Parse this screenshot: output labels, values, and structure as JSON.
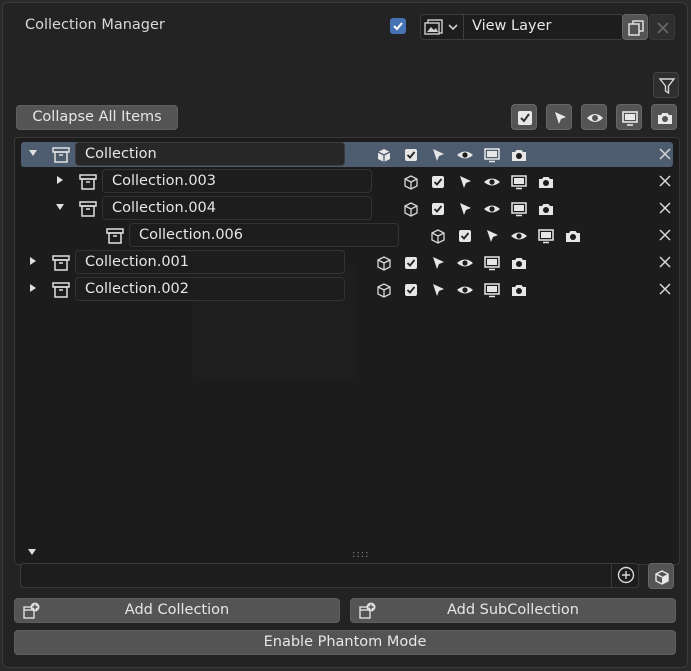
{
  "header": {
    "title": "Collection Manager",
    "view_layer_label": "View Layer"
  },
  "toolbar": {
    "collapse_label": "Collapse All Items"
  },
  "tree": [
    {
      "name": "Collection",
      "expanded": true,
      "selected": true
    },
    {
      "name": "Collection.003",
      "expanded": false
    },
    {
      "name": "Collection.004",
      "expanded": true
    },
    {
      "name": "Collection.006"
    },
    {
      "name": "Collection.001",
      "expanded": false
    },
    {
      "name": "Collection.002",
      "expanded": false
    }
  ],
  "footer": {
    "add_collection_label": "Add Collection",
    "add_subcollection_label": "Add SubCollection",
    "phantom_label": "Enable Phantom Mode"
  },
  "icons": [
    "checkbox-icon",
    "cursor-select-icon",
    "eye-icon",
    "monitor-icon",
    "camera-icon",
    "cube-icon",
    "close-icon",
    "filter-icon",
    "collection-icon",
    "copy-icon",
    "image-icon",
    "zoom-in-icon"
  ],
  "colors": {
    "accent": "#4772b3",
    "selected_row": "#4e5c70",
    "panel": "#232323"
  }
}
